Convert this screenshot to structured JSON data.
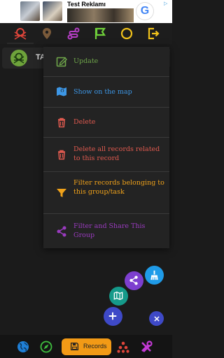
{
  "ad": {
    "title": "Test Reklamı",
    "choices": "▷",
    "logo_letter": "G"
  },
  "tabs": [
    "map-grid",
    "location-pin",
    "route",
    "flag",
    "circle",
    "logout"
  ],
  "list_item": {
    "label": "TA"
  },
  "menu": {
    "items": [
      {
        "label": "Update",
        "color": "#6fa64a"
      },
      {
        "label": "Show on the map",
        "color": "#3d97e6"
      },
      {
        "label": "Delete",
        "color": "#e05a4f"
      },
      {
        "label": "Delete all records related to this record",
        "color": "#e05a4f"
      },
      {
        "label": "Filter records belonging to this group/task",
        "color": "#f0a21a"
      },
      {
        "label": "Filter and Share This Group",
        "color": "#9a3bbf"
      }
    ]
  },
  "bottom_nav": {
    "records_label": "Records"
  },
  "colors": {
    "tab_red": "#e0453a",
    "tab_brown": "#7a5a3a",
    "tab_purple": "#b63ec6",
    "tab_green": "#6fcf3a",
    "tab_yellow": "#f1c21b",
    "fab_blue": "#1f9be8",
    "fab_purple": "#7d3fcf",
    "fab_teal": "#159a8a",
    "fab_indigo": "#3e49c7",
    "accent_orange": "#f29a16"
  }
}
